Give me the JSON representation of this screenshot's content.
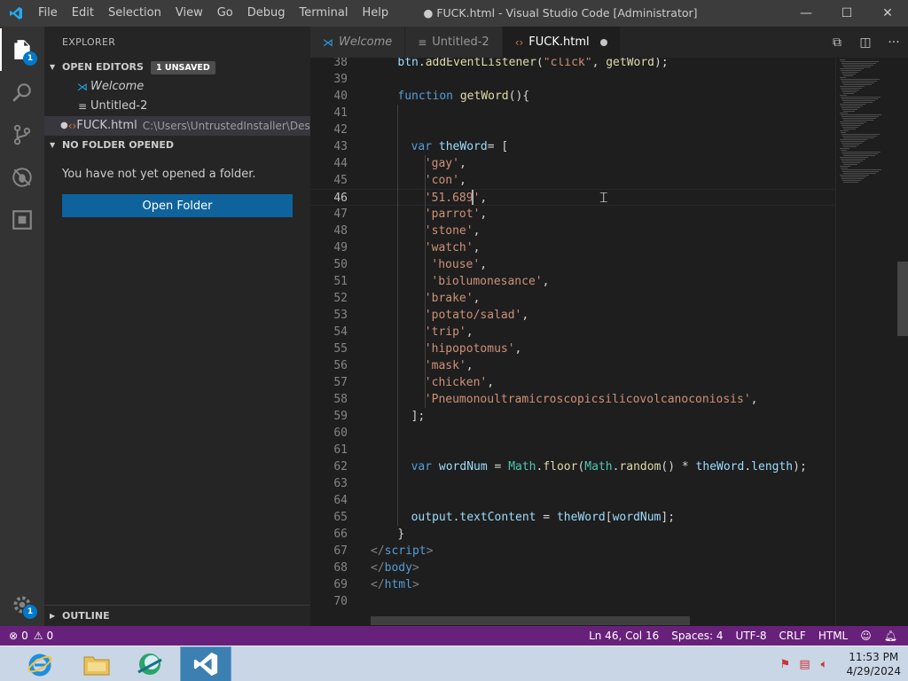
{
  "titlebar": {
    "menu": [
      "File",
      "Edit",
      "Selection",
      "View",
      "Go",
      "Debug",
      "Terminal",
      "Help"
    ],
    "window_title": "● FUCK.html - Visual Studio Code [Administrator]",
    "minimize": "—",
    "maximize": "☐",
    "close": "✕"
  },
  "activity": {
    "explorer_badge": "1",
    "settings_badge": "1"
  },
  "sidebar": {
    "title": "EXPLORER",
    "open_editors_label": "OPEN EDITORS",
    "unsaved_label": "1 UNSAVED",
    "open_editors": [
      {
        "name": "Welcome",
        "icon": "vscode-icon",
        "dirty": false,
        "path": ""
      },
      {
        "name": "Untitled-2",
        "icon": "lines-icon",
        "dirty": false,
        "path": ""
      },
      {
        "name": "FUCK.html",
        "icon": "html-icon",
        "dirty": true,
        "path": "C:\\Users\\UntrustedInstaller\\Desk..."
      }
    ],
    "no_folder_label": "NO FOLDER OPENED",
    "no_folder_text": "You have not yet opened a folder.",
    "open_folder_button": "Open Folder",
    "outline_label": "OUTLINE"
  },
  "tabs": [
    {
      "label": "Welcome",
      "icon": "vscode-icon",
      "active": false
    },
    {
      "label": "Untitled-2",
      "icon": "lines-icon",
      "active": false
    },
    {
      "label": "FUCK.html",
      "icon": "html-icon",
      "active": true,
      "dirty": true
    }
  ],
  "code": {
    "current_line": 46,
    "lines": [
      {
        "n": "38",
        "tokens": [
          [
            "v",
            "btn"
          ],
          [
            "p",
            "."
          ],
          [
            "f",
            "addEventListener"
          ],
          [
            "p",
            "("
          ],
          [
            "s",
            "\"click\""
          ],
          [
            "p",
            ", "
          ],
          [
            "f",
            "getWord"
          ],
          [
            "p",
            ");"
          ]
        ],
        "indent": 4
      },
      {
        "n": "39",
        "tokens": [],
        "indent": 0
      },
      {
        "n": "40",
        "tokens": [
          [
            "k",
            "function"
          ],
          [
            "p",
            " "
          ],
          [
            "f",
            "getWord"
          ],
          [
            "p",
            "(){"
          ]
        ],
        "indent": 4
      },
      {
        "n": "41",
        "tokens": [],
        "indent": 0
      },
      {
        "n": "42",
        "tokens": [],
        "indent": 0
      },
      {
        "n": "43",
        "tokens": [
          [
            "k",
            "var"
          ],
          [
            "p",
            " "
          ],
          [
            "v",
            "theWord"
          ],
          [
            "p",
            "= ["
          ]
        ],
        "indent": 6
      },
      {
        "n": "44",
        "tokens": [
          [
            "s",
            "'gay'"
          ],
          [
            "p",
            ","
          ]
        ],
        "indent": 8
      },
      {
        "n": "45",
        "tokens": [
          [
            "s",
            "'con'"
          ],
          [
            "p",
            ","
          ]
        ],
        "indent": 8
      },
      {
        "n": "46",
        "tokens": [
          [
            "s",
            "'51.689'"
          ],
          [
            "p",
            ","
          ]
        ],
        "indent": 8
      },
      {
        "n": "47",
        "tokens": [
          [
            "s",
            "'parrot'"
          ],
          [
            "p",
            ","
          ]
        ],
        "indent": 8
      },
      {
        "n": "48",
        "tokens": [
          [
            "s",
            "'stone'"
          ],
          [
            "p",
            ","
          ]
        ],
        "indent": 8
      },
      {
        "n": "49",
        "tokens": [
          [
            "s",
            "'watch'"
          ],
          [
            "p",
            ","
          ]
        ],
        "indent": 8
      },
      {
        "n": "50",
        "tokens": [
          [
            "s",
            "'house'"
          ],
          [
            "p",
            ","
          ]
        ],
        "indent": 9
      },
      {
        "n": "51",
        "tokens": [
          [
            "s",
            "'biolumonesance'"
          ],
          [
            "p",
            ","
          ]
        ],
        "indent": 9
      },
      {
        "n": "52",
        "tokens": [
          [
            "s",
            "'brake'"
          ],
          [
            "p",
            ","
          ]
        ],
        "indent": 8
      },
      {
        "n": "53",
        "tokens": [
          [
            "s",
            "'potato/salad'"
          ],
          [
            "p",
            ","
          ]
        ],
        "indent": 8
      },
      {
        "n": "54",
        "tokens": [
          [
            "s",
            "'trip'"
          ],
          [
            "p",
            ","
          ]
        ],
        "indent": 8
      },
      {
        "n": "55",
        "tokens": [
          [
            "s",
            "'hipopotomus'"
          ],
          [
            "p",
            ","
          ]
        ],
        "indent": 8
      },
      {
        "n": "56",
        "tokens": [
          [
            "s",
            "'mask'"
          ],
          [
            "p",
            ","
          ]
        ],
        "indent": 8
      },
      {
        "n": "57",
        "tokens": [
          [
            "s",
            "'chicken'"
          ],
          [
            "p",
            ","
          ]
        ],
        "indent": 8
      },
      {
        "n": "58",
        "tokens": [
          [
            "s",
            "'Pneumonoultramicroscopicsilicovolcanoconiosis'"
          ],
          [
            "p",
            ","
          ]
        ],
        "indent": 8
      },
      {
        "n": "59",
        "tokens": [
          [
            "p",
            "];"
          ]
        ],
        "indent": 6
      },
      {
        "n": "60",
        "tokens": [],
        "indent": 0
      },
      {
        "n": "61",
        "tokens": [],
        "indent": 0
      },
      {
        "n": "62",
        "tokens": [
          [
            "k",
            "var"
          ],
          [
            "p",
            " "
          ],
          [
            "v",
            "wordNum"
          ],
          [
            "p",
            " = "
          ],
          [
            "c",
            "Math"
          ],
          [
            "p",
            "."
          ],
          [
            "f",
            "floor"
          ],
          [
            "p",
            "("
          ],
          [
            "c",
            "Math"
          ],
          [
            "p",
            "."
          ],
          [
            "f",
            "random"
          ],
          [
            "p",
            "() * "
          ],
          [
            "v",
            "theWord"
          ],
          [
            "p",
            "."
          ],
          [
            "v",
            "length"
          ],
          [
            "p",
            ");"
          ]
        ],
        "indent": 6
      },
      {
        "n": "63",
        "tokens": [],
        "indent": 0
      },
      {
        "n": "64",
        "tokens": [],
        "indent": 0
      },
      {
        "n": "65",
        "tokens": [
          [
            "v",
            "output"
          ],
          [
            "p",
            "."
          ],
          [
            "v",
            "textContent"
          ],
          [
            "p",
            " = "
          ],
          [
            "v",
            "theWord"
          ],
          [
            "p",
            "["
          ],
          [
            "v",
            "wordNum"
          ],
          [
            "p",
            "];"
          ]
        ],
        "indent": 6
      },
      {
        "n": "66",
        "tokens": [
          [
            "p",
            "}"
          ]
        ],
        "indent": 4
      },
      {
        "n": "67",
        "tokens": [
          [
            "t",
            "</"
          ],
          [
            "k",
            "script"
          ],
          [
            "t",
            ">"
          ]
        ],
        "indent": 0
      },
      {
        "n": "68",
        "tokens": [
          [
            "t",
            "</"
          ],
          [
            "k",
            "body"
          ],
          [
            "t",
            ">"
          ]
        ],
        "indent": 0
      },
      {
        "n": "69",
        "tokens": [
          [
            "t",
            "</"
          ],
          [
            "k",
            "html"
          ],
          [
            "t",
            ">"
          ]
        ],
        "indent": 0
      },
      {
        "n": "70",
        "tokens": [],
        "indent": 0
      }
    ]
  },
  "statusbar": {
    "errors": "0",
    "warnings": "0",
    "position": "Ln 46, Col 16",
    "spaces": "Spaces: 4",
    "encoding": "UTF-8",
    "eol": "CRLF",
    "language": "HTML"
  },
  "taskbar": {
    "time": "11:53 PM",
    "date": "4/29/2024"
  },
  "colors": {
    "statusbar": "#68217a",
    "accent": "#007acc",
    "button": "#0e639c"
  }
}
